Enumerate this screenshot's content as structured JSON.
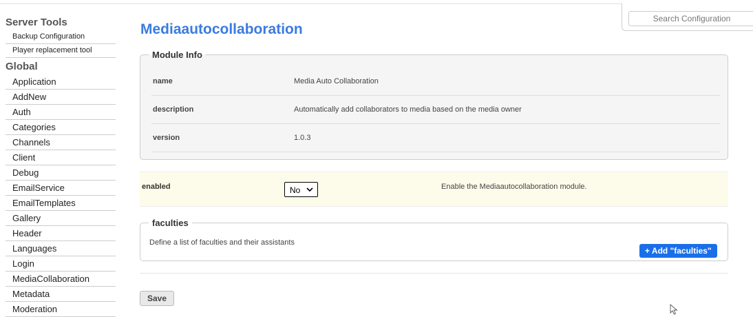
{
  "search": {
    "placeholder": "Search Configuration"
  },
  "sidebar": {
    "server_tools": {
      "heading": "Server Tools",
      "items": [
        "Backup Configuration",
        "Player replacement tool"
      ]
    },
    "global": {
      "heading": "Global",
      "items": [
        "Application",
        "AddNew",
        "Auth",
        "Categories",
        "Channels",
        "Client",
        "Debug",
        "EmailService",
        "EmailTemplates",
        "Gallery",
        "Header",
        "Languages",
        "Login",
        "MediaCollaboration",
        "Metadata",
        "Moderation"
      ]
    }
  },
  "main": {
    "title": "Mediaautocollaboration",
    "module_info": {
      "legend": "Module Info",
      "rows": [
        {
          "key": "name",
          "value": "Media Auto Collaboration"
        },
        {
          "key": "description",
          "value": "Automatically add collaborators to media based on the media owner"
        },
        {
          "key": "version",
          "value": "1.0.3"
        }
      ]
    },
    "enabled": {
      "label": "enabled",
      "selected": "No",
      "description": "Enable the Mediaautocollaboration module."
    },
    "faculties": {
      "legend": "faculties",
      "description": "Define a list of faculties and their assistants",
      "add_label": "+ Add \"faculties\""
    },
    "save_label": "Save"
  },
  "colors": {
    "title": "#3a7be0",
    "add_button": "#1a6fe8",
    "enabled_row_bg": "#fdfcea",
    "module_info_bg": "#f5f5f5"
  }
}
